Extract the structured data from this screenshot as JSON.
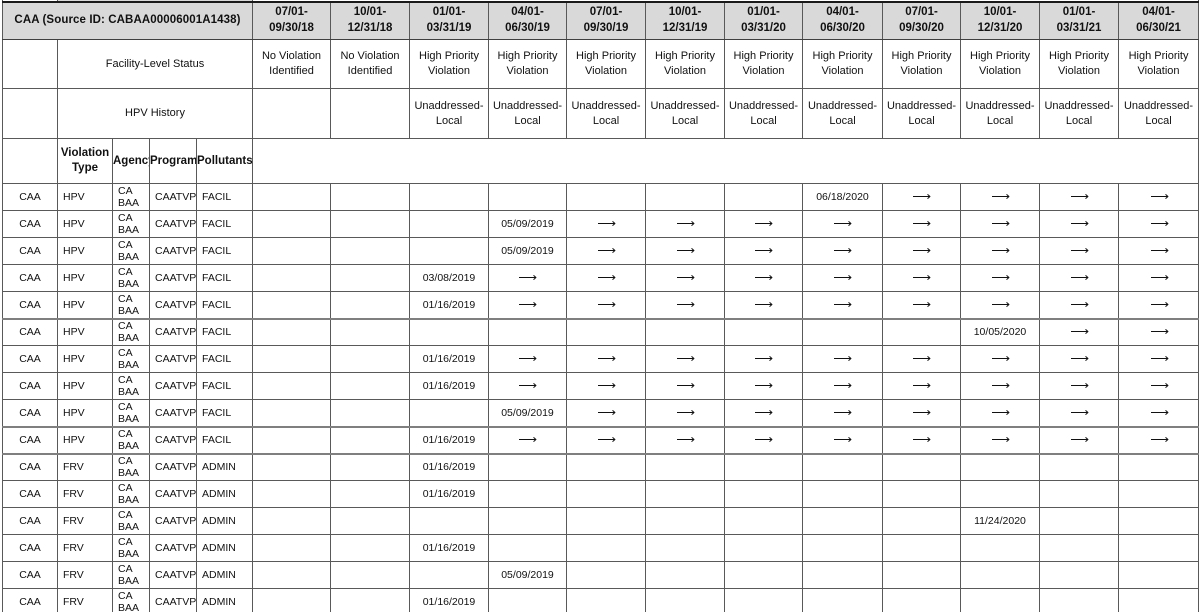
{
  "header": {
    "title": "CAA (Source ID: CABAA00006001A1438)",
    "facility_status_label": "Facility-Level Status",
    "hpv_history_label": "HPV History",
    "periods": [
      "07/01-09/30/18",
      "10/01-12/31/18",
      "01/01-03/31/19",
      "04/01-06/30/19",
      "07/01-09/30/19",
      "10/01-12/31/19",
      "01/01-03/31/20",
      "04/01-06/30/20",
      "07/01-09/30/20",
      "10/01-12/31/20",
      "01/01-03/31/21",
      "04/01-06/30/21"
    ],
    "period_lines": [
      [
        "07/01-",
        "09/30/18"
      ],
      [
        "10/01-",
        "12/31/18"
      ],
      [
        "01/01-",
        "03/31/19"
      ],
      [
        "04/01-",
        "06/30/19"
      ],
      [
        "07/01-",
        "09/30/19"
      ],
      [
        "10/01-",
        "12/31/19"
      ],
      [
        "01/01-",
        "03/31/20"
      ],
      [
        "04/01-",
        "06/30/20"
      ],
      [
        "07/01-",
        "09/30/20"
      ],
      [
        "10/01-",
        "12/31/20"
      ],
      [
        "01/01-",
        "03/31/21"
      ],
      [
        "04/01-",
        "06/30/21"
      ]
    ],
    "facility_status": [
      {
        "text": "No Violation Identified",
        "lines": [
          "No Violation",
          "Identified"
        ],
        "style": "blue"
      },
      {
        "text": "No Violation Identified",
        "lines": [
          "No Violation",
          "Identified"
        ],
        "style": "blue"
      },
      {
        "text": "High Priority Violation",
        "lines": [
          "High Priority",
          "Violation"
        ],
        "style": "red"
      },
      {
        "text": "High Priority Violation",
        "lines": [
          "High Priority",
          "Violation"
        ],
        "style": "red"
      },
      {
        "text": "High Priority Violation",
        "lines": [
          "High Priority",
          "Violation"
        ],
        "style": "red"
      },
      {
        "text": "High Priority Violation",
        "lines": [
          "High Priority",
          "Violation"
        ],
        "style": "red"
      },
      {
        "text": "High Priority Violation",
        "lines": [
          "High Priority",
          "Violation"
        ],
        "style": "red"
      },
      {
        "text": "High Priority Violation",
        "lines": [
          "High Priority",
          "Violation"
        ],
        "style": "red"
      },
      {
        "text": "High Priority Violation",
        "lines": [
          "High Priority",
          "Violation"
        ],
        "style": "red"
      },
      {
        "text": "High Priority Violation",
        "lines": [
          "High Priority",
          "Violation"
        ],
        "style": "red"
      },
      {
        "text": "High Priority Violation",
        "lines": [
          "High Priority",
          "Violation"
        ],
        "style": "red"
      },
      {
        "text": "High Priority Violation",
        "lines": [
          "High Priority",
          "Violation"
        ],
        "style": "red"
      }
    ],
    "hpv_history": [
      {
        "lines": [
          "",
          ""
        ]
      },
      {
        "lines": [
          "",
          ""
        ]
      },
      {
        "lines": [
          "Unaddressed-",
          "Local"
        ]
      },
      {
        "lines": [
          "Unaddressed-",
          "Local"
        ]
      },
      {
        "lines": [
          "Unaddressed-",
          "Local"
        ]
      },
      {
        "lines": [
          "Unaddressed-",
          "Local"
        ]
      },
      {
        "lines": [
          "Unaddressed-",
          "Local"
        ]
      },
      {
        "lines": [
          "Unaddressed-",
          "Local"
        ]
      },
      {
        "lines": [
          "Unaddressed-",
          "Local"
        ]
      },
      {
        "lines": [
          "Unaddressed-",
          "Local"
        ]
      },
      {
        "lines": [
          "Unaddressed-",
          "Local"
        ]
      },
      {
        "lines": [
          "Unaddressed-",
          "Local"
        ]
      }
    ]
  },
  "columns": {
    "statute": "",
    "violation_type_l1": "Violation",
    "violation_type_l2": "Type",
    "agency": "Agency",
    "programs": "Programs",
    "pollutants": "Pollutants"
  },
  "colors": {
    "no_violation_bg": "#4a8fcf",
    "high_priority_bg": "#b03425",
    "header_bg": "#d9d9d9",
    "border": "#595959",
    "text": "#111111"
  },
  "arrow_glyph": "⟶",
  "rows": [
    {
      "statute": "CAA",
      "violation_type": "HPV",
      "agency": "CA BAA",
      "programs": "CAATVP",
      "pollutants": "FACIL",
      "cells": [
        "",
        "",
        "",
        "",
        "",
        "",
        "",
        "06/18/2020",
        "arrow",
        "arrow",
        "arrow",
        "arrow"
      ],
      "group_end": false
    },
    {
      "statute": "CAA",
      "violation_type": "HPV",
      "agency": "CA BAA",
      "programs": "CAATVP",
      "pollutants": "FACIL",
      "cells": [
        "",
        "",
        "",
        "05/09/2019",
        "arrow",
        "arrow",
        "arrow",
        "arrow",
        "arrow",
        "arrow",
        "arrow",
        "arrow"
      ],
      "group_end": false
    },
    {
      "statute": "CAA",
      "violation_type": "HPV",
      "agency": "CA BAA",
      "programs": "CAATVP",
      "pollutants": "FACIL",
      "cells": [
        "",
        "",
        "",
        "05/09/2019",
        "arrow",
        "arrow",
        "arrow",
        "arrow",
        "arrow",
        "arrow",
        "arrow",
        "arrow"
      ],
      "group_end": false
    },
    {
      "statute": "CAA",
      "violation_type": "HPV",
      "agency": "CA BAA",
      "programs": "CAATVP",
      "pollutants": "FACIL",
      "cells": [
        "",
        "",
        "03/08/2019",
        "arrow",
        "arrow",
        "arrow",
        "arrow",
        "arrow",
        "arrow",
        "arrow",
        "arrow",
        "arrow"
      ],
      "group_end": false
    },
    {
      "statute": "CAA",
      "violation_type": "HPV",
      "agency": "CA BAA",
      "programs": "CAATVP",
      "pollutants": "FACIL",
      "cells": [
        "",
        "",
        "01/16/2019",
        "arrow",
        "arrow",
        "arrow",
        "arrow",
        "arrow",
        "arrow",
        "arrow",
        "arrow",
        "arrow"
      ],
      "group_end": true
    },
    {
      "statute": "CAA",
      "violation_type": "HPV",
      "agency": "CA BAA",
      "programs": "CAATVP",
      "pollutants": "FACIL",
      "cells": [
        "",
        "",
        "",
        "",
        "",
        "",
        "",
        "",
        "",
        "10/05/2020",
        "arrow",
        "arrow"
      ],
      "group_end": false
    },
    {
      "statute": "CAA",
      "violation_type": "HPV",
      "agency": "CA BAA",
      "programs": "CAATVP",
      "pollutants": "FACIL",
      "cells": [
        "",
        "",
        "01/16/2019",
        "arrow",
        "arrow",
        "arrow",
        "arrow",
        "arrow",
        "arrow",
        "arrow",
        "arrow",
        "arrow"
      ],
      "group_end": false
    },
    {
      "statute": "CAA",
      "violation_type": "HPV",
      "agency": "CA BAA",
      "programs": "CAATVP",
      "pollutants": "FACIL",
      "cells": [
        "",
        "",
        "01/16/2019",
        "arrow",
        "arrow",
        "arrow",
        "arrow",
        "arrow",
        "arrow",
        "arrow",
        "arrow",
        "arrow"
      ],
      "group_end": false
    },
    {
      "statute": "CAA",
      "violation_type": "HPV",
      "agency": "CA BAA",
      "programs": "CAATVP",
      "pollutants": "FACIL",
      "cells": [
        "",
        "",
        "",
        "05/09/2019",
        "arrow",
        "arrow",
        "arrow",
        "arrow",
        "arrow",
        "arrow",
        "arrow",
        "arrow"
      ],
      "group_end": true
    },
    {
      "statute": "CAA",
      "violation_type": "HPV",
      "agency": "CA BAA",
      "programs": "CAATVP",
      "pollutants": "FACIL",
      "cells": [
        "",
        "",
        "01/16/2019",
        "arrow",
        "arrow",
        "arrow",
        "arrow",
        "arrow",
        "arrow",
        "arrow",
        "arrow",
        "arrow"
      ],
      "group_end": true
    },
    {
      "statute": "CAA",
      "violation_type": "FRV",
      "agency": "CA BAA",
      "programs": "CAATVP",
      "pollutants": "ADMIN",
      "cells": [
        "",
        "",
        "01/16/2019",
        "",
        "",
        "",
        "",
        "",
        "",
        "",
        "",
        ""
      ],
      "group_end": false
    },
    {
      "statute": "CAA",
      "violation_type": "FRV",
      "agency": "CA BAA",
      "programs": "CAATVP",
      "pollutants": "ADMIN",
      "cells": [
        "",
        "",
        "01/16/2019",
        "",
        "",
        "",
        "",
        "",
        "",
        "",
        "",
        ""
      ],
      "group_end": false
    },
    {
      "statute": "CAA",
      "violation_type": "FRV",
      "agency": "CA BAA",
      "programs": "CAATVP",
      "pollutants": "ADMIN",
      "cells": [
        "",
        "",
        "",
        "",
        "",
        "",
        "",
        "",
        "",
        "11/24/2020",
        "",
        ""
      ],
      "group_end": false
    },
    {
      "statute": "CAA",
      "violation_type": "FRV",
      "agency": "CA BAA",
      "programs": "CAATVP",
      "pollutants": "ADMIN",
      "cells": [
        "",
        "",
        "01/16/2019",
        "",
        "",
        "",
        "",
        "",
        "",
        "",
        "",
        ""
      ],
      "group_end": false
    },
    {
      "statute": "CAA",
      "violation_type": "FRV",
      "agency": "CA BAA",
      "programs": "CAATVP",
      "pollutants": "ADMIN",
      "cells": [
        "",
        "",
        "",
        "05/09/2019",
        "",
        "",
        "",
        "",
        "",
        "",
        "",
        ""
      ],
      "group_end": false
    },
    {
      "statute": "CAA",
      "violation_type": "FRV",
      "agency": "CA BAA",
      "programs": "CAATVP",
      "pollutants": "ADMIN",
      "cells": [
        "",
        "",
        "01/16/2019",
        "",
        "",
        "",
        "",
        "",
        "",
        "",
        "",
        ""
      ],
      "group_end": false
    }
  ]
}
